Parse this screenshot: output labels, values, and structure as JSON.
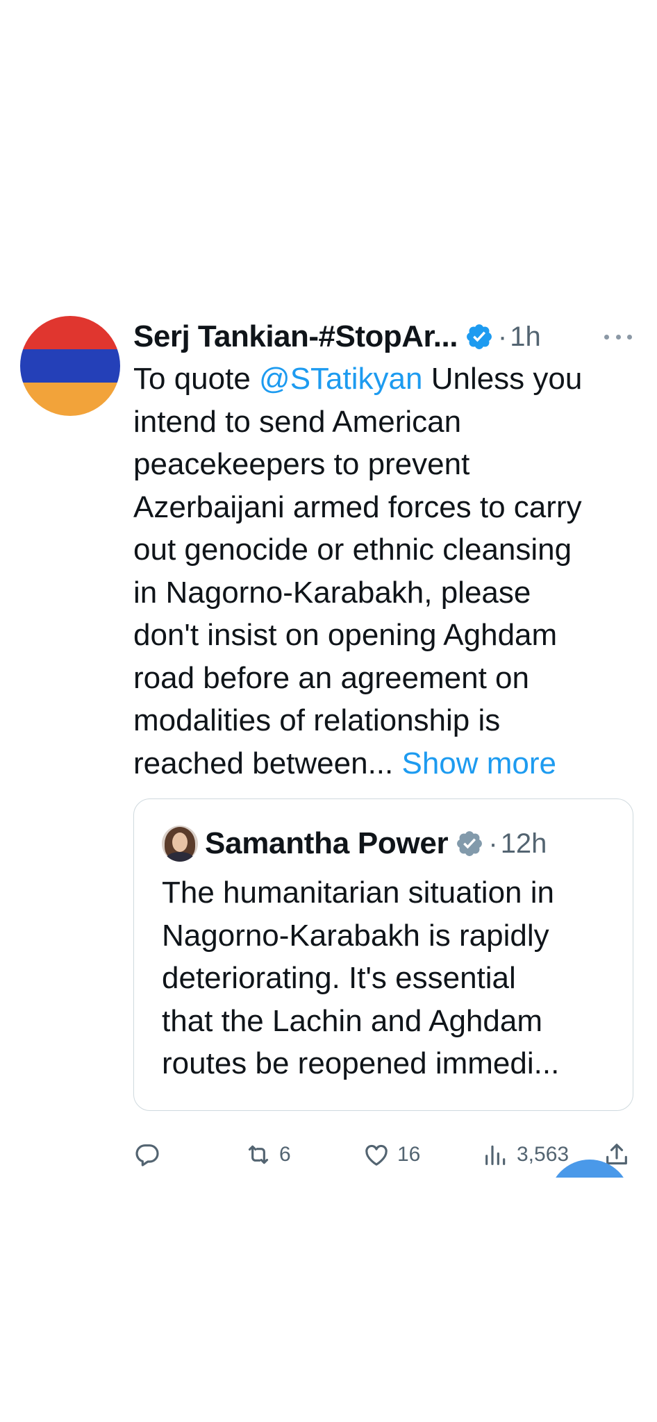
{
  "tweet": {
    "author_name": "Serj Tankian-#StopAr...",
    "dot": "·",
    "time": "1h",
    "avatar_colors": [
      "#e0362f",
      "#2440b8",
      "#f2a33a"
    ],
    "text_lines": [
      {
        "before": "To quote ",
        "mention": "@STatikyan",
        "after": " Unless you"
      },
      {
        "text": "intend to send American"
      },
      {
        "text": "peacekeepers to prevent"
      },
      {
        "text": "Azerbaijani armed forces to carry"
      },
      {
        "text": "out genocide or ethnic cleansing"
      },
      {
        "text": "in Nagorno-Karabakh, please"
      },
      {
        "text": "don't insist on opening Aghdam"
      },
      {
        "text": "road before an agreement on"
      },
      {
        "text": "modalities of relationship is"
      },
      {
        "text": "reached between... ",
        "link": "Show more"
      }
    ]
  },
  "quote": {
    "author_name": "Samantha Power",
    "dot": "·",
    "time": "12h",
    "text_lines": [
      "The humanitarian situation in",
      "Nagorno-Karabakh is rapidly",
      "deteriorating. It's essential",
      "that the Lachin and Aghdam",
      "routes be reopened immedi..."
    ]
  },
  "actions": {
    "reply_count": "",
    "retweet_count": "6",
    "like_count": "16",
    "views_count": "3,563"
  },
  "colors": {
    "link": "#1d9bf0",
    "verified_blue": "#1d9bf0",
    "verified_gray": "#829aab",
    "muted": "#536471",
    "fab": "#4a99e9"
  }
}
